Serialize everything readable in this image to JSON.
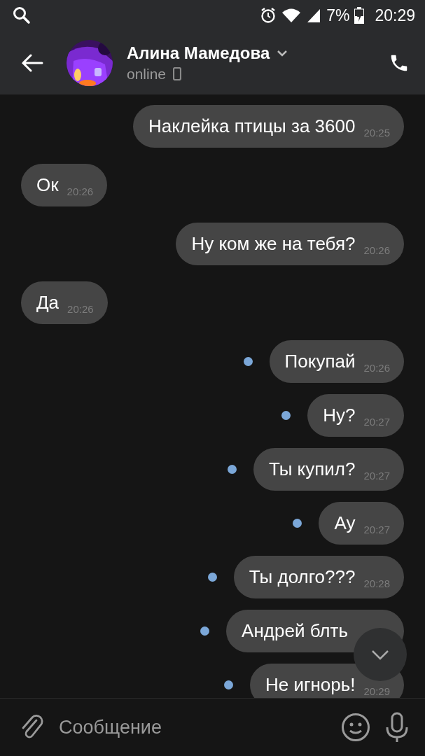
{
  "status_bar": {
    "battery": "7%",
    "time": "20:29"
  },
  "header": {
    "name": "Алина Мамедова",
    "status": "online"
  },
  "messages": [
    {
      "kind": "outgoing",
      "text": "Наклейка птицы за 3600",
      "time": "20:25",
      "unread": false
    },
    {
      "kind": "incoming",
      "text": "Ок",
      "time": "20:26",
      "unread": false
    },
    {
      "kind": "outgoing",
      "text": "Ну ком же на тебя?",
      "time": "20:26",
      "unread": false
    },
    {
      "kind": "incoming",
      "text": "Да",
      "time": "20:26",
      "unread": false
    },
    {
      "kind": "outgoing",
      "text": "Покупай",
      "time": "20:26",
      "unread": true
    },
    {
      "kind": "outgoing",
      "text": "Ну?",
      "time": "20:27",
      "unread": true
    },
    {
      "kind": "outgoing",
      "text": "Ты купил?",
      "time": "20:27",
      "unread": true
    },
    {
      "kind": "outgoing",
      "text": "Ау",
      "time": "20:27",
      "unread": true
    },
    {
      "kind": "outgoing",
      "text": "Ты долго???",
      "time": "20:28",
      "unread": true
    },
    {
      "kind": "outgoing",
      "text": "Андрей блть",
      "unread": true
    },
    {
      "kind": "outgoing",
      "text": "Не игнорь!",
      "time": "20:29",
      "unread": true
    }
  ],
  "composer": {
    "placeholder": "Сообщение"
  }
}
